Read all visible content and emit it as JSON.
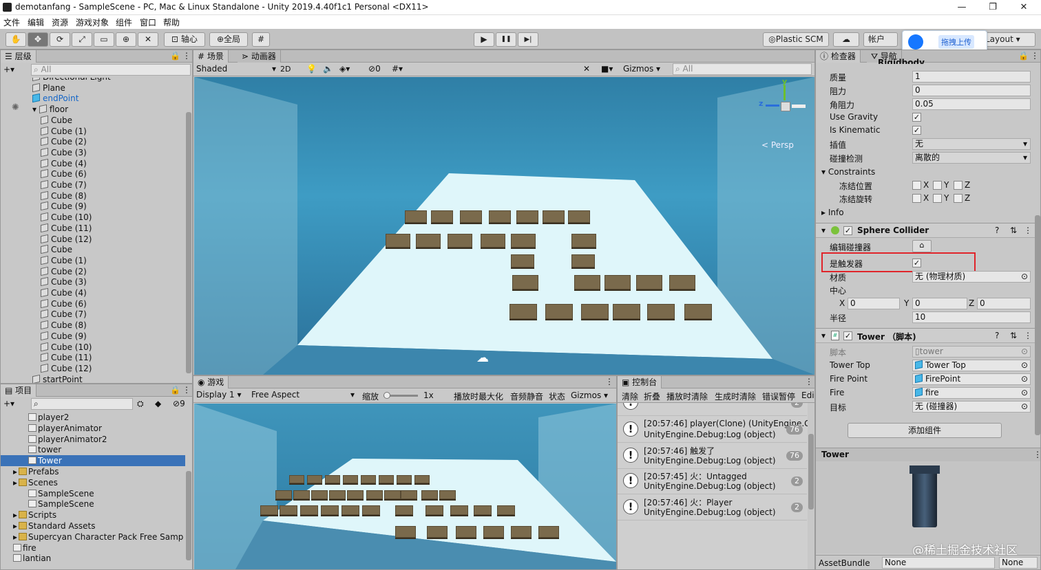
{
  "window": {
    "title": "demotanfang - SampleScene - PC, Mac & Linux Standalone - Unity 2019.4.40f1c1 Personal <DX11>",
    "min": "—",
    "max": "❐",
    "close": "✕"
  },
  "menu": [
    "文件",
    "编辑",
    "资源",
    "游戏对象",
    "组件",
    "窗口",
    "帮助"
  ],
  "toolbar": {
    "pivot": "轴心",
    "global": "全局",
    "play": "▶",
    "pause": "❚❚",
    "step": "▶|",
    "plastic": "Plastic SCM",
    "account": "帐户",
    "layout": "Layout",
    "upload": "拖拽上传"
  },
  "hierarchy": {
    "tab": "层级",
    "search_placeholder": "All",
    "items": [
      {
        "label": "Directional Light",
        "indent": 1,
        "icon": "cube"
      },
      {
        "label": "Plane",
        "indent": 1,
        "icon": "cube"
      },
      {
        "label": "endPoint",
        "indent": 1,
        "icon": "prefab",
        "blue": true
      },
      {
        "label": "floor",
        "indent": 1,
        "icon": "cube",
        "expanded": true
      },
      {
        "label": "Cube",
        "indent": 2,
        "icon": "cube"
      },
      {
        "label": "Cube (1)",
        "indent": 2,
        "icon": "cube"
      },
      {
        "label": "Cube (2)",
        "indent": 2,
        "icon": "cube"
      },
      {
        "label": "Cube (3)",
        "indent": 2,
        "icon": "cube"
      },
      {
        "label": "Cube (4)",
        "indent": 2,
        "icon": "cube"
      },
      {
        "label": "Cube (6)",
        "indent": 2,
        "icon": "cube"
      },
      {
        "label": "Cube (7)",
        "indent": 2,
        "icon": "cube"
      },
      {
        "label": "Cube (8)",
        "indent": 2,
        "icon": "cube"
      },
      {
        "label": "Cube (9)",
        "indent": 2,
        "icon": "cube"
      },
      {
        "label": "Cube (10)",
        "indent": 2,
        "icon": "cube"
      },
      {
        "label": "Cube (11)",
        "indent": 2,
        "icon": "cube"
      },
      {
        "label": "Cube (12)",
        "indent": 2,
        "icon": "cube"
      },
      {
        "label": "Cube",
        "indent": 2,
        "icon": "cube"
      },
      {
        "label": "Cube (1)",
        "indent": 2,
        "icon": "cube"
      },
      {
        "label": "Cube (2)",
        "indent": 2,
        "icon": "cube"
      },
      {
        "label": "Cube (3)",
        "indent": 2,
        "icon": "cube"
      },
      {
        "label": "Cube (4)",
        "indent": 2,
        "icon": "cube"
      },
      {
        "label": "Cube (6)",
        "indent": 2,
        "icon": "cube"
      },
      {
        "label": "Cube (7)",
        "indent": 2,
        "icon": "cube"
      },
      {
        "label": "Cube (8)",
        "indent": 2,
        "icon": "cube"
      },
      {
        "label": "Cube (9)",
        "indent": 2,
        "icon": "cube"
      },
      {
        "label": "Cube (10)",
        "indent": 2,
        "icon": "cube"
      },
      {
        "label": "Cube (11)",
        "indent": 2,
        "icon": "cube"
      },
      {
        "label": "Cube (12)",
        "indent": 2,
        "icon": "cube"
      },
      {
        "label": "startPoint",
        "indent": 1,
        "icon": "cube"
      }
    ]
  },
  "scene": {
    "tab_scene": "场景",
    "tab_animator": "动画器",
    "shading": "Shaded",
    "mode2d": "2D",
    "fx_count": "0",
    "gizmos": "Gizmos",
    "search_placeholder": "All",
    "persp": "Persp",
    "axis_y": "y",
    "axis_z": "z"
  },
  "project": {
    "tab": "项目",
    "hidden_count": "9",
    "items": [
      {
        "label": "player2",
        "indent": 2
      },
      {
        "label": "playerAnimator",
        "indent": 2
      },
      {
        "label": "playerAnimator2",
        "indent": 2
      },
      {
        "label": "tower",
        "indent": 2
      },
      {
        "label": "Tower",
        "indent": 2,
        "selected": true
      },
      {
        "label": "Prefabs",
        "indent": 1,
        "folder": true
      },
      {
        "label": "Scenes",
        "indent": 1,
        "folder": true
      },
      {
        "label": "SampleScene",
        "indent": 2
      },
      {
        "label": "SampleScene",
        "indent": 2
      },
      {
        "label": "Scripts",
        "indent": 1,
        "folder": true
      },
      {
        "label": "Standard Assets",
        "indent": 1,
        "folder": true
      },
      {
        "label": "Supercyan Character Pack Free Samp",
        "indent": 1,
        "folder": true
      },
      {
        "label": "fire",
        "indent": 1
      },
      {
        "label": "lantian",
        "indent": 1
      }
    ]
  },
  "game": {
    "tab": "游戏",
    "display": "Display 1",
    "aspect": "Free Aspect",
    "scale_label": "缩放",
    "scale_value": "1x",
    "maximize": "播放时最大化",
    "mute": "音频静音",
    "stats": "状态",
    "gizmos": "Gizmos"
  },
  "console": {
    "tab": "控制台",
    "buttons": [
      "清除",
      "折叠",
      "播放时清除",
      "生成时清除",
      "错误暂停",
      "Edi"
    ],
    "rows": [
      {
        "l1": "UnityEngine.Debug:Log (object)",
        "l2": "",
        "count": "2"
      },
      {
        "l1": "[20:57:46] player(Clone) (UnityEngine.Ga",
        "l2": "UnityEngine.Debug:Log (object)",
        "count": "76"
      },
      {
        "l1": "[20:57:46] 触发了",
        "l2": "UnityEngine.Debug:Log (object)",
        "count": "76"
      },
      {
        "l1": "[20:57:45] 火：Untagged",
        "l2": "UnityEngine.Debug:Log (object)",
        "count": "2"
      },
      {
        "l1": "[20:57:46] 火：Player",
        "l2": "UnityEngine.Debug:Log (object)",
        "count": "2"
      }
    ]
  },
  "inspector": {
    "tab_inspector": "检查器",
    "tab_nav": "导航",
    "partial_header": "Rigidbody",
    "rigidbody": [
      {
        "label": "质量",
        "value": "1"
      },
      {
        "label": "阻力",
        "value": "0"
      },
      {
        "label": "角阻力",
        "value": "0.05"
      }
    ],
    "use_gravity": "Use Gravity",
    "is_kinematic": "Is Kinematic",
    "interpolate_label": "插值",
    "interpolate_value": "无",
    "collision_label": "碰撞检测",
    "collision_value": "离散的",
    "constraints": "Constraints",
    "freeze_pos": "冻结位置",
    "freeze_rot": "冻结旋转",
    "x": "X",
    "y": "Y",
    "z": "Z",
    "info": "Info",
    "sphere": {
      "title": "Sphere Collider",
      "edit": "编辑碰撞器",
      "trigger": "是触发器",
      "material_label": "材质",
      "material_value": "无 (物理材质)",
      "center": "中心",
      "cx": "0",
      "cy": "0",
      "cz": "0",
      "radius_label": "半径",
      "radius_value": "10"
    },
    "tower": {
      "title": "Tower （脚本)",
      "script_label": "脚本",
      "script_value": "tower",
      "top_label": "Tower Top",
      "top_value": "Tower Top",
      "fp_label": "Fire Point",
      "fp_value": "FirePoint",
      "fire_label": "Fire",
      "fire_value": "fire",
      "target_label": "目标",
      "target_value": "无 (碰撞器)"
    },
    "add_component": "添加组件",
    "preview_title": "Tower",
    "assetbundle_label": "AssetBundle",
    "assetbundle_value": "None",
    "assetbundle_variant": "None",
    "watermark": "@稀土掘金技术社区",
    "highlight_color": "#e0242a"
  }
}
